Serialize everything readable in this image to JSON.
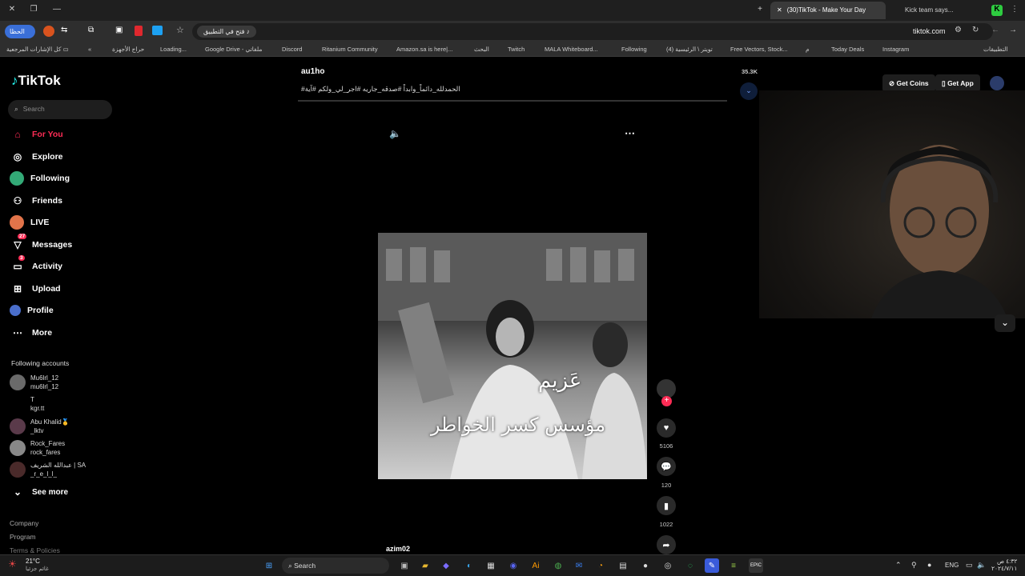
{
  "browser": {
    "tabs": [
      {
        "title": "(30)TikTok - Make Your Day"
      },
      {
        "title": "Kick team says..."
      }
    ],
    "open_in_app_label": "فتح في التطبيق",
    "profile_label": "الحظا",
    "url": "tiktok.com",
    "bookmarks": [
      {
        "label": "كل الإشارات المرجعية"
      },
      {
        "label": "حراج الأجهزة"
      },
      {
        "label": "Loading..."
      },
      {
        "label": "Google Drive - ملفاتي"
      },
      {
        "label": "Discord"
      },
      {
        "label": "Ritanium Community"
      },
      {
        "label": "Amazon.sa is here|..."
      },
      {
        "label": "البحث"
      },
      {
        "label": "Twitch"
      },
      {
        "label": "MALA Whiteboard..."
      },
      {
        "label": "Following"
      },
      {
        "label": "(4) تويتر \\ الرئيسية"
      },
      {
        "label": "Free Vectors, Stock..."
      },
      {
        "label": "م"
      },
      {
        "label": "Today Deals"
      },
      {
        "label": "Instagram"
      },
      {
        "label": "التطبيقات"
      }
    ]
  },
  "tiktok": {
    "logo": "TikTok",
    "search_placeholder": "Search",
    "nav": [
      {
        "label": "For You",
        "icon": "home-icon",
        "active": true
      },
      {
        "label": "Explore",
        "icon": "compass-icon"
      },
      {
        "label": "Following",
        "icon": "following-icon"
      },
      {
        "label": "Friends",
        "icon": "friends-icon"
      },
      {
        "label": "LIVE",
        "icon": "live-icon"
      },
      {
        "label": "Messages",
        "icon": "messages-icon",
        "badge": "27"
      },
      {
        "label": "Activity",
        "icon": "activity-icon",
        "badge": "3"
      },
      {
        "label": "Upload",
        "icon": "upload-icon"
      },
      {
        "label": "Profile",
        "icon": "profile-icon"
      },
      {
        "label": "More",
        "icon": "more-icon"
      }
    ],
    "following_header": "Following accounts",
    "following": [
      {
        "name": "Mu6lrl_12",
        "handle": "mu6lrl_12"
      },
      {
        "name": "T",
        "handle": "kgr.tt"
      },
      {
        "name": "Abu Khalid🥇",
        "handle": "_lktv"
      },
      {
        "name": "Rock_Fares",
        "handle": "rock_fares"
      },
      {
        "name": "عبدالله الشريف | SA",
        "handle": "_r_e_l_l_"
      }
    ],
    "see_more": "See more",
    "footer_links": [
      "Company",
      "Program",
      "Terms & Policies"
    ],
    "prev_post": {
      "author": "au1ho",
      "caption": "#الحمدلله_دائماً_وابداً #صدقه_جاريه #اجر_لي_ولكم #آية",
      "likes": "35.3K"
    },
    "video": {
      "overlay_line1": "عَزيم",
      "overlay_line2": "مؤسس كسر الخواطر",
      "likes": "5106",
      "comments": "120",
      "saves": "1022",
      "author": "azim02"
    },
    "header_buttons": {
      "get_coins": "Get Coins",
      "get_app": "Get App"
    }
  },
  "taskbar": {
    "weather_temp": "21°C",
    "weather_text": "غائم جزئيا",
    "search_label": "Search",
    "lang": "ENG",
    "time": "٤:٣٢ ص",
    "date": "٢٠٢٤/٧/١١"
  },
  "colors": {
    "accent": "#fe2c55",
    "bg": "#000000"
  }
}
